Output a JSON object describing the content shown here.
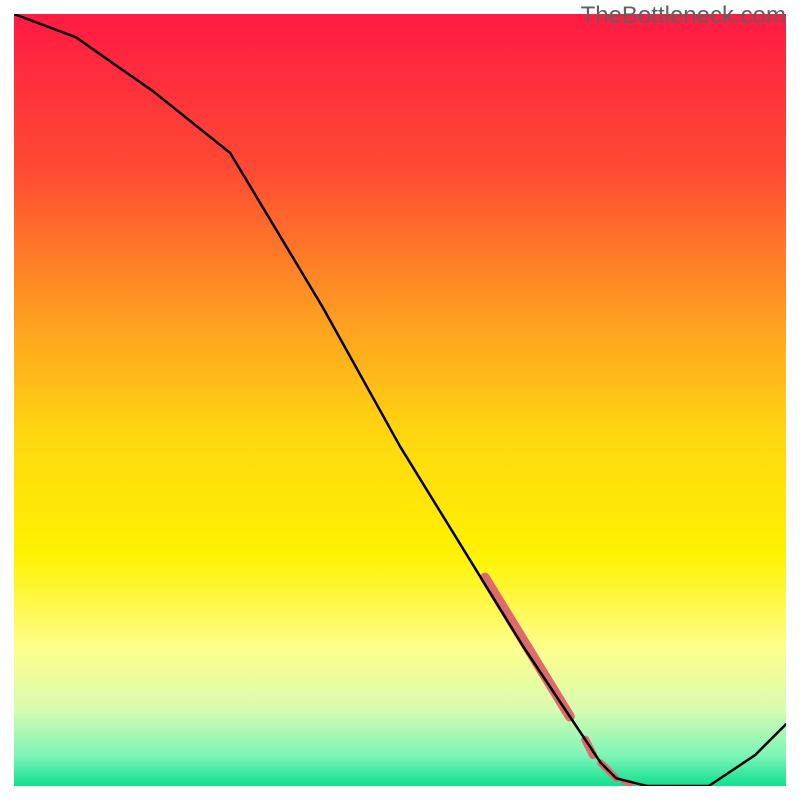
{
  "watermark": "TheBottleneck.com",
  "chart_data": {
    "type": "line",
    "title": "",
    "xlabel": "",
    "ylabel": "",
    "xlim": [
      0,
      100
    ],
    "ylim": [
      0,
      100
    ],
    "background_gradient": {
      "stops": [
        {
          "offset": 0.0,
          "color": "#ff1a43"
        },
        {
          "offset": 0.2,
          "color": "#ff4a33"
        },
        {
          "offset": 0.4,
          "color": "#ffa020"
        },
        {
          "offset": 0.55,
          "color": "#ffd810"
        },
        {
          "offset": 0.7,
          "color": "#fff200"
        },
        {
          "offset": 0.82,
          "color": "#fdfe8a"
        },
        {
          "offset": 0.9,
          "color": "#d8fcb0"
        },
        {
          "offset": 0.96,
          "color": "#7ef5b8"
        },
        {
          "offset": 1.0,
          "color": "#10e090"
        }
      ]
    },
    "series": [
      {
        "name": "curve",
        "color": "#000000",
        "x": [
          0,
          8,
          18,
          28,
          40,
          50,
          58,
          66,
          72,
          76,
          78,
          82,
          90,
          96,
          100
        ],
        "y": [
          100,
          97,
          90,
          82,
          62,
          44,
          31,
          18,
          9,
          3,
          1,
          0,
          0,
          4,
          8
        ]
      }
    ],
    "highlights": {
      "name": "marker-band",
      "color": "#e06a6a",
      "segments": [
        {
          "x0": 61,
          "y0": 27,
          "x1": 72,
          "y1": 9,
          "width": 10
        },
        {
          "x0": 74,
          "y0": 6,
          "x1": 75,
          "y1": 4,
          "width": 8
        },
        {
          "x0": 76,
          "y0": 3,
          "x1": 78,
          "y1": 1,
          "width": 7
        },
        {
          "x0": 79,
          "y0": 0.5,
          "x1": 80,
          "y1": 0.3,
          "width": 6
        }
      ]
    }
  }
}
